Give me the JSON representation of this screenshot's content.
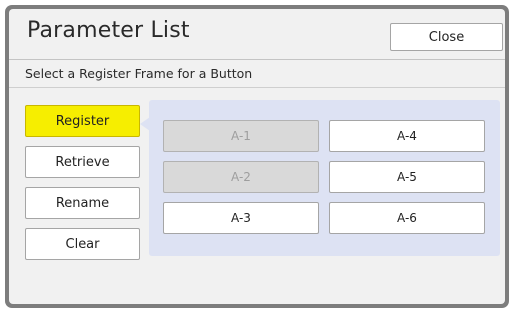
{
  "dialog": {
    "title": "Parameter List",
    "close_label": "Close",
    "subtitle": "Select a Register Frame for a Button"
  },
  "side_buttons": [
    {
      "label": "Register",
      "active": true
    },
    {
      "label": "Retrieve",
      "active": false
    },
    {
      "label": "Rename",
      "active": false
    },
    {
      "label": "Clear",
      "active": false
    }
  ],
  "frames": [
    {
      "label": "A-1",
      "enabled": false
    },
    {
      "label": "A-2",
      "enabled": false
    },
    {
      "label": "A-3",
      "enabled": true
    },
    {
      "label": "A-4",
      "enabled": true
    },
    {
      "label": "A-5",
      "enabled": true
    },
    {
      "label": "A-6",
      "enabled": true
    }
  ],
  "colors": {
    "active_button": "#f6ee00",
    "frame_panel": "#dde2f3",
    "disabled_button": "#d9d9d9"
  }
}
